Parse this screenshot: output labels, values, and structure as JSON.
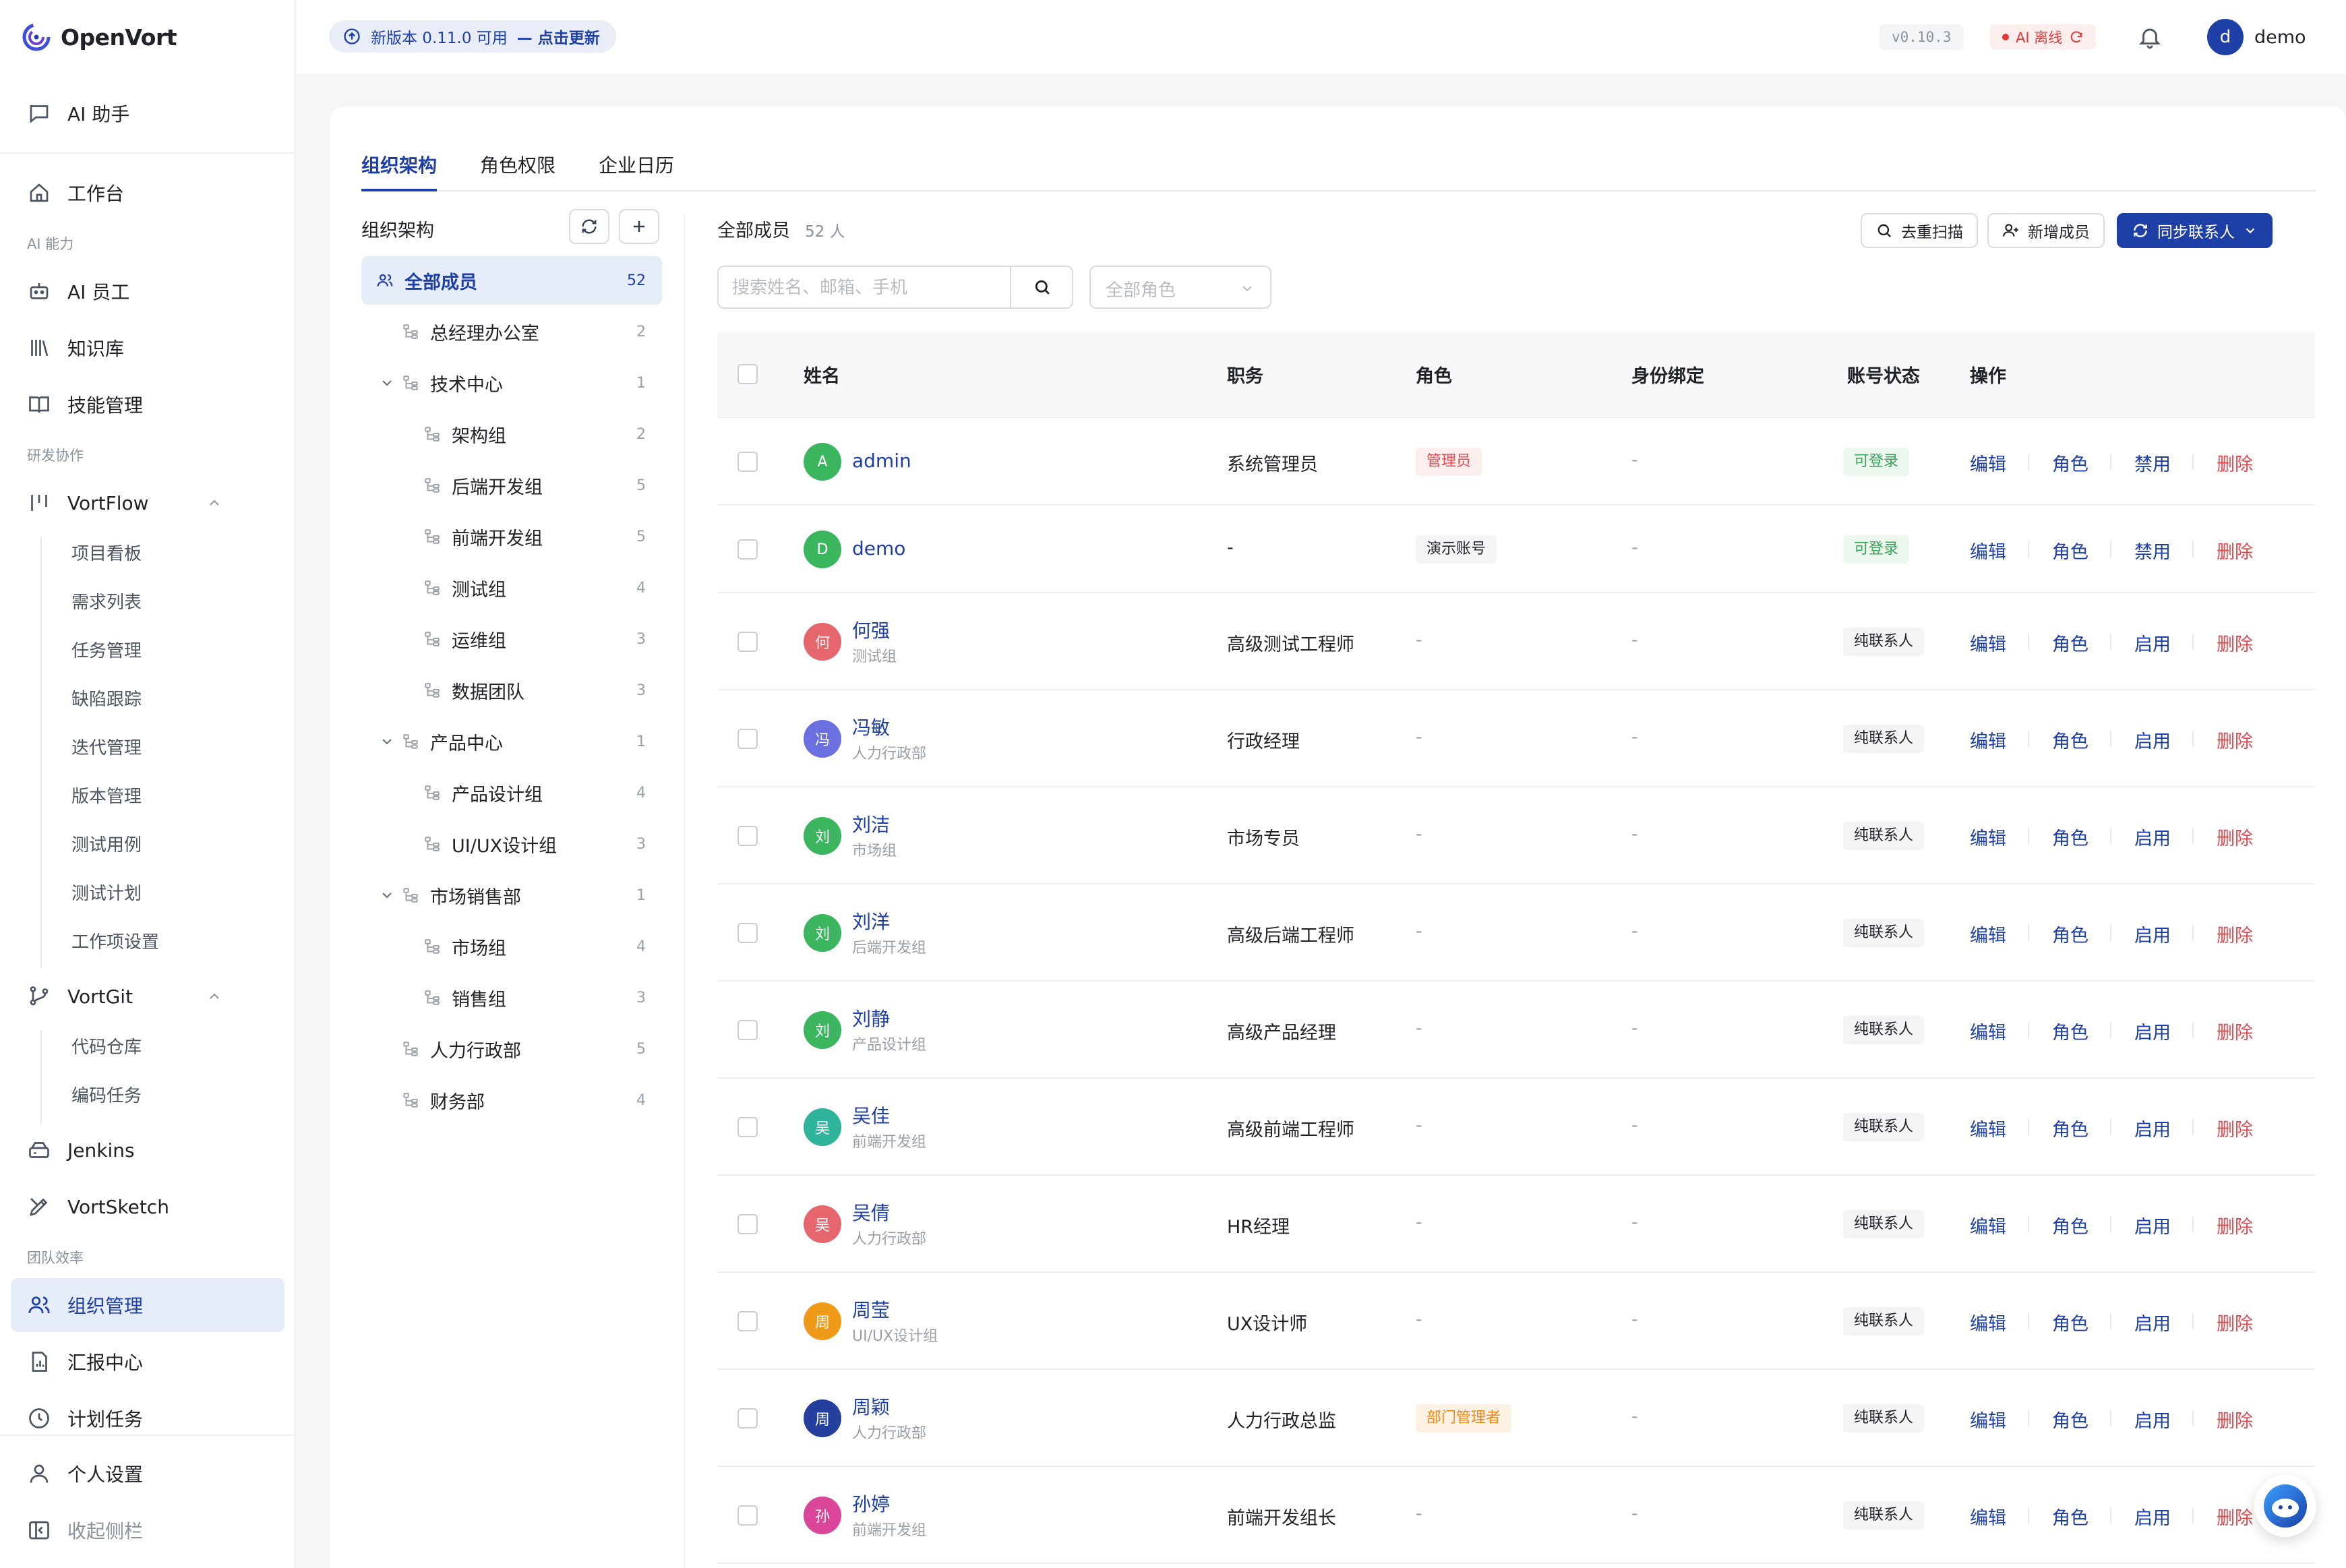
{
  "app": {
    "name": "OpenVort"
  },
  "sidebar": {
    "ai_assistant": "AI 助手",
    "workbench": "工作台",
    "group_ai": "AI 能力",
    "ai_employee": "AI 员工",
    "knowledge": "知识库",
    "skills": "技能管理",
    "group_dev": "研发协作",
    "vortflow": "VortFlow",
    "vortflow_items": [
      "项目看板",
      "需求列表",
      "任务管理",
      "缺陷跟踪",
      "迭代管理",
      "版本管理",
      "测试用例",
      "测试计划",
      "工作项设置"
    ],
    "vortgit": "VortGit",
    "vortgit_items": [
      "代码仓库",
      "编码任务"
    ],
    "jenkins": "Jenkins",
    "vortsketch": "VortSketch",
    "group_team": "团队效率",
    "org": "组织管理",
    "reports": "汇报中心",
    "schedule": "计划任务",
    "personal": "个人设置",
    "collapse": "收起侧栏"
  },
  "header": {
    "update_text": "新版本 0.11.0 可用",
    "update_link": "— 点击更新",
    "version": "v0.10.3",
    "ai_status": "AI 离线",
    "user_initial": "d",
    "user_name": "demo"
  },
  "tabs": [
    "组织架构",
    "角色权限",
    "企业日历"
  ],
  "org_tree": {
    "title": "组织架构",
    "nodes": [
      {
        "label": "全部成员",
        "count": "52"
      },
      {
        "label": "总经理办公室",
        "count": "2"
      },
      {
        "label": "技术中心",
        "count": "1"
      },
      {
        "label": "架构组",
        "count": "2"
      },
      {
        "label": "后端开发组",
        "count": "5"
      },
      {
        "label": "前端开发组",
        "count": "5"
      },
      {
        "label": "测试组",
        "count": "4"
      },
      {
        "label": "运维组",
        "count": "3"
      },
      {
        "label": "数据团队",
        "count": "3"
      },
      {
        "label": "产品中心",
        "count": "1"
      },
      {
        "label": "产品设计组",
        "count": "4"
      },
      {
        "label": "UI/UX设计组",
        "count": "3"
      },
      {
        "label": "市场销售部",
        "count": "1"
      },
      {
        "label": "市场组",
        "count": "4"
      },
      {
        "label": "销售组",
        "count": "3"
      },
      {
        "label": "人力行政部",
        "count": "5"
      },
      {
        "label": "财务部",
        "count": "4"
      }
    ]
  },
  "members": {
    "title": "全部成员",
    "count": "52 人",
    "btn_dedupe": "去重扫描",
    "btn_add": "新增成员",
    "btn_sync": "同步联系人",
    "search_placeholder": "搜索姓名、邮箱、手机",
    "role_filter": "全部角色",
    "columns": [
      "姓名",
      "职务",
      "角色",
      "身份绑定",
      "账号状态",
      "操作"
    ],
    "actions": [
      "编辑",
      "角色",
      "删除"
    ],
    "rows": [
      {
        "avatar": "A",
        "color": "#3bb55e",
        "name": "admin",
        "dept": "",
        "title": "系统管理员",
        "role": "管理员",
        "role_style": "red",
        "binding": "-",
        "status": "可登录",
        "status_style": "green",
        "toggle": "禁用"
      },
      {
        "avatar": "D",
        "color": "#3bb55e",
        "name": "demo",
        "dept": "",
        "title": "-",
        "role": "演示账号",
        "role_style": "gray",
        "binding": "-",
        "status": "可登录",
        "status_style": "green",
        "toggle": "禁用"
      },
      {
        "avatar": "何",
        "color": "#e5676d",
        "name": "何强",
        "dept": "测试组",
        "title": "高级测试工程师",
        "role": "-",
        "role_style": "none",
        "binding": "-",
        "status": "纯联系人",
        "status_style": "gray",
        "toggle": "启用"
      },
      {
        "avatar": "冯",
        "color": "#6b6fe0",
        "name": "冯敏",
        "dept": "人力行政部",
        "title": "行政经理",
        "role": "-",
        "role_style": "none",
        "binding": "-",
        "status": "纯联系人",
        "status_style": "gray",
        "toggle": "启用"
      },
      {
        "avatar": "刘",
        "color": "#3bb55e",
        "name": "刘洁",
        "dept": "市场组",
        "title": "市场专员",
        "role": "-",
        "role_style": "none",
        "binding": "-",
        "status": "纯联系人",
        "status_style": "gray",
        "toggle": "启用"
      },
      {
        "avatar": "刘",
        "color": "#3bb55e",
        "name": "刘洋",
        "dept": "后端开发组",
        "title": "高级后端工程师",
        "role": "-",
        "role_style": "none",
        "binding": "-",
        "status": "纯联系人",
        "status_style": "gray",
        "toggle": "启用"
      },
      {
        "avatar": "刘",
        "color": "#3bb55e",
        "name": "刘静",
        "dept": "产品设计组",
        "title": "高级产品经理",
        "role": "-",
        "role_style": "none",
        "binding": "-",
        "status": "纯联系人",
        "status_style": "gray",
        "toggle": "启用"
      },
      {
        "avatar": "吴",
        "color": "#2fb39a",
        "name": "吴佳",
        "dept": "前端开发组",
        "title": "高级前端工程师",
        "role": "-",
        "role_style": "none",
        "binding": "-",
        "status": "纯联系人",
        "status_style": "gray",
        "toggle": "启用"
      },
      {
        "avatar": "吴",
        "color": "#e5676d",
        "name": "吴倩",
        "dept": "人力行政部",
        "title": "HR经理",
        "role": "-",
        "role_style": "none",
        "binding": "-",
        "status": "纯联系人",
        "status_style": "gray",
        "toggle": "启用"
      },
      {
        "avatar": "周",
        "color": "#f09a1a",
        "name": "周莹",
        "dept": "UI/UX设计组",
        "title": "UX设计师",
        "role": "-",
        "role_style": "none",
        "binding": "-",
        "status": "纯联系人",
        "status_style": "gray",
        "toggle": "启用"
      },
      {
        "avatar": "周",
        "color": "#243f9e",
        "name": "周颖",
        "dept": "人力行政部",
        "title": "人力行政总监",
        "role": "部门管理者",
        "role_style": "orange",
        "binding": "-",
        "status": "纯联系人",
        "status_style": "gray",
        "toggle": "启用"
      },
      {
        "avatar": "孙",
        "color": "#d9469a",
        "name": "孙婷",
        "dept": "前端开发组",
        "title": "前端开发组长",
        "role": "-",
        "role_style": "none",
        "binding": "-",
        "status": "纯联系人",
        "status_style": "gray",
        "toggle": "启用"
      }
    ]
  }
}
